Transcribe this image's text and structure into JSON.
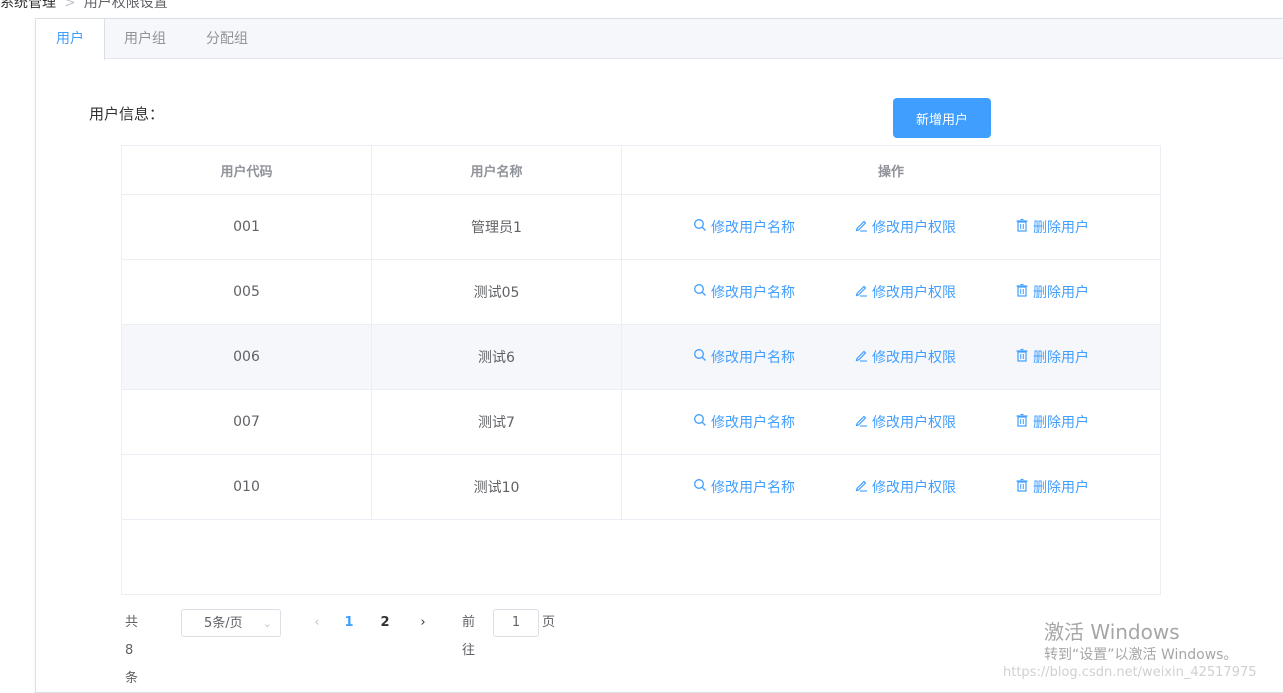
{
  "breadcrumb": {
    "root": "系统管理",
    "separator": ">",
    "current": "用户权限设置"
  },
  "tabs": [
    {
      "label": "用户",
      "active": true
    },
    {
      "label": "用户组",
      "active": false
    },
    {
      "label": "分配组",
      "active": false
    }
  ],
  "section": {
    "title": "用户信息：",
    "add_button": "新增用户"
  },
  "table": {
    "columns": [
      "用户代码",
      "用户名称",
      "操作"
    ],
    "actions": {
      "rename": "修改用户名称",
      "permissions": "修改用户权限",
      "delete": "删除用户"
    },
    "rows": [
      {
        "code": "001",
        "name": "管理员1"
      },
      {
        "code": "005",
        "name": "测试05"
      },
      {
        "code": "006",
        "name": "测试6"
      },
      {
        "code": "007",
        "name": "测试7"
      },
      {
        "code": "010",
        "name": "测试10"
      }
    ]
  },
  "pagination": {
    "total": "共 8 条",
    "page_size": "5条/页",
    "pages": [
      "1",
      "2"
    ],
    "current_page": "1",
    "goto_label": "前往",
    "goto_value": "1",
    "goto_suffix": "页"
  },
  "watermark": {
    "title": "激活 Windows",
    "subtitle": "转到“设置”以激活 Windows。",
    "url": "https://blog.csdn.net/weixin_42517975"
  },
  "colors": {
    "primary": "#409eff",
    "text": "#606266",
    "header_text": "#909399",
    "border": "#ebeef5",
    "hover_row": "#f5f7fa"
  }
}
